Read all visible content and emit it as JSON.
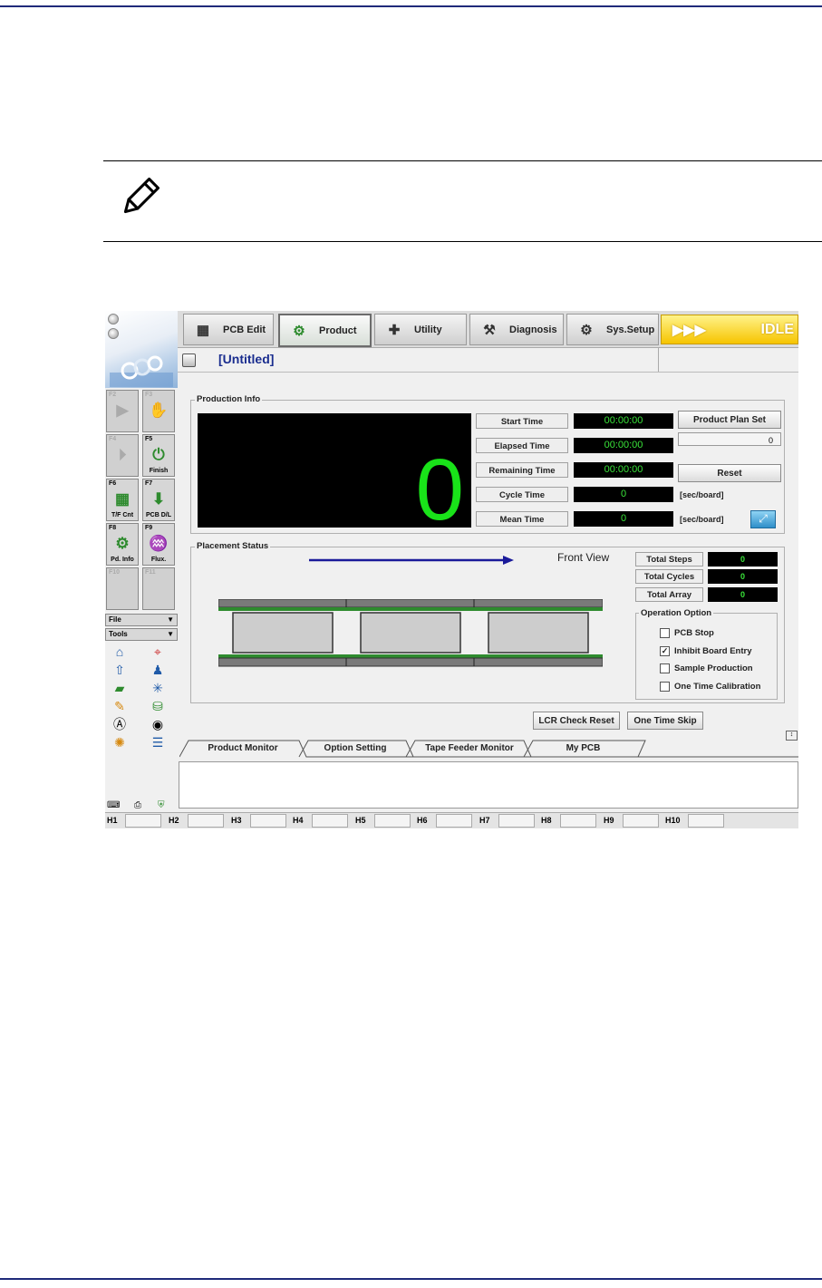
{
  "app": {
    "left_panel": {
      "fkeys": [
        {
          "key": "F2",
          "label": "",
          "icon": "play-icon",
          "disabled": true
        },
        {
          "key": "F3",
          "label": "",
          "icon": "hand-icon",
          "disabled": true
        },
        {
          "key": "F4",
          "label": "",
          "icon": "step-icon",
          "disabled": true
        },
        {
          "key": "F5",
          "label": "Finish",
          "icon": "finish-icon",
          "disabled": false
        },
        {
          "key": "F6",
          "label": "T/F Cnt",
          "icon": "grid-icon",
          "disabled": false
        },
        {
          "key": "F7",
          "label": "PCB D/L",
          "icon": "download-icon",
          "disabled": false
        },
        {
          "key": "F8",
          "label": "Pd. Info",
          "icon": "gear-icon",
          "disabled": false
        },
        {
          "key": "F9",
          "label": "Flux.",
          "icon": "flux-icon",
          "disabled": false
        },
        {
          "key": "F10",
          "label": "",
          "icon": "",
          "disabled": true
        },
        {
          "key": "F11",
          "label": "",
          "icon": "",
          "disabled": true
        }
      ],
      "file_label": "File",
      "tools_label": "Tools"
    },
    "main_tabs": [
      {
        "label": "PCB Edit",
        "icon": "pcb-edit-icon"
      },
      {
        "label": "Product",
        "icon": "product-gear-icon"
      },
      {
        "label": "Utility",
        "icon": "utility-icon"
      },
      {
        "label": "Diagnosis",
        "icon": "diagnosis-icon"
      },
      {
        "label": "Sys.Setup",
        "icon": "sys-setup-icon"
      }
    ],
    "status": {
      "arrows": "▶▶▶",
      "text": "IDLE",
      "color": "#f6c400"
    },
    "file_title": "[Untitled]",
    "production_info": {
      "label": "Production Info",
      "count": "0",
      "times": [
        {
          "label": "Start Time",
          "value": "00:00:00"
        },
        {
          "label": "Elapsed Time",
          "value": "00:00:00"
        },
        {
          "label": "Remaining Time",
          "value": "00:00:00"
        },
        {
          "label": "Cycle Time",
          "value": "0"
        },
        {
          "label": "Mean Time",
          "value": "0"
        }
      ],
      "unit": "[sec/board]",
      "plan_button": "Product Plan Set",
      "plan_value": "0",
      "reset_button": "Reset"
    },
    "placement_status": {
      "label": "Placement Status",
      "view_label": "Front View",
      "stats": [
        {
          "label": "Total Steps",
          "value": "0"
        },
        {
          "label": "Total Cycles",
          "value": "0"
        },
        {
          "label": "Total Array",
          "value": "0"
        }
      ],
      "operation_option": {
        "label": "Operation Option",
        "options": [
          {
            "label": "PCB Stop",
            "checked": false
          },
          {
            "label": "Inhibit Board Entry",
            "checked": true
          },
          {
            "label": "Sample Production",
            "checked": false
          },
          {
            "label": "One Time Calibration",
            "checked": false
          }
        ]
      }
    },
    "actions": {
      "lcr_reset": "LCR Check Reset",
      "one_time_skip": "One Time Skip"
    },
    "bottom_tabs": [
      "Product Monitor",
      "Option Setting",
      "Tape Feeder Monitor",
      "My PCB"
    ],
    "heads": [
      "H1",
      "H2",
      "H3",
      "H4",
      "H5",
      "H6",
      "H7",
      "H8",
      "H9",
      "H10"
    ],
    "colors": {
      "display_green": "#19e319",
      "title_blue": "#1a2d8f",
      "board_green": "#2e8b2e"
    }
  }
}
